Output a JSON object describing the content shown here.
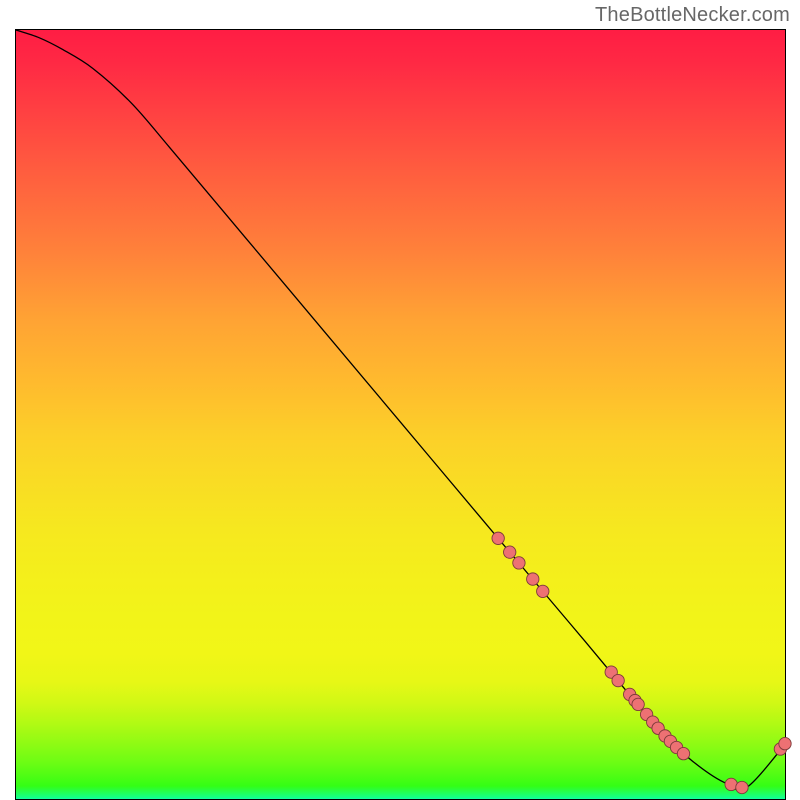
{
  "attribution": "TheBottleNecker.com",
  "chart_data": {
    "type": "line",
    "title": "",
    "xlabel": "",
    "ylabel": "",
    "xlim": [
      0,
      100
    ],
    "ylim": [
      0,
      100
    ],
    "series": [
      {
        "name": "curve",
        "x": [
          0,
          3,
          6,
          10,
          15,
          20,
          30,
          40,
          50,
          60,
          68,
          74,
          80,
          84,
          88,
          92,
          95,
          100
        ],
        "y": [
          100,
          99,
          97.5,
          95,
          90.5,
          84.7,
          72.8,
          60.9,
          49,
          37.1,
          27.6,
          20.5,
          13.3,
          8.6,
          4.9,
          2.2,
          1.5,
          7.1
        ]
      }
    ],
    "markers": {
      "name": "highlight-points",
      "color": "#ed7173",
      "x": [
        62.7,
        64.2,
        65.4,
        67.2,
        68.5,
        77.4,
        78.3,
        79.8,
        80.5,
        80.9,
        82.0,
        82.8,
        83.5,
        84.4,
        85.1,
        85.9,
        86.8,
        93.0,
        94.4,
        99.4,
        100.0
      ],
      "y": [
        33.9,
        32.1,
        30.7,
        28.6,
        27.0,
        16.5,
        15.4,
        13.6,
        12.8,
        12.3,
        11.0,
        10.0,
        9.2,
        8.2,
        7.5,
        6.7,
        5.9,
        1.9,
        1.5,
        6.5,
        7.2
      ]
    },
    "background_gradient": {
      "stops": [
        {
          "pct": 0.0,
          "color": "#ff1d44"
        },
        {
          "pct": 4.3,
          "color": "#ff2944"
        },
        {
          "pct": 18.1,
          "color": "#ff5c3f"
        },
        {
          "pct": 29.0,
          "color": "#ff823a"
        },
        {
          "pct": 37.7,
          "color": "#ffa334"
        },
        {
          "pct": 45.7,
          "color": "#ffba2e"
        },
        {
          "pct": 52.6,
          "color": "#fccf29"
        },
        {
          "pct": 58.7,
          "color": "#f9dc24"
        },
        {
          "pct": 65.0,
          "color": "#f6e81f"
        },
        {
          "pct": 71.0,
          "color": "#f4ef1b"
        },
        {
          "pct": 76.3,
          "color": "#f2f419"
        },
        {
          "pct": 81.2,
          "color": "#f1f617"
        },
        {
          "pct": 84.7,
          "color": "#e7f716"
        },
        {
          "pct": 87.5,
          "color": "#d1f815"
        },
        {
          "pct": 90.2,
          "color": "#b1fa14"
        },
        {
          "pct": 92.8,
          "color": "#8ffb14"
        },
        {
          "pct": 95.2,
          "color": "#6dfd14"
        },
        {
          "pct": 97.0,
          "color": "#4efd14"
        },
        {
          "pct": 98.3,
          "color": "#34fe15"
        },
        {
          "pct": 99.8,
          "color": "#14ff86"
        },
        {
          "pct": 100.0,
          "color": "#13ffa8"
        }
      ]
    }
  }
}
